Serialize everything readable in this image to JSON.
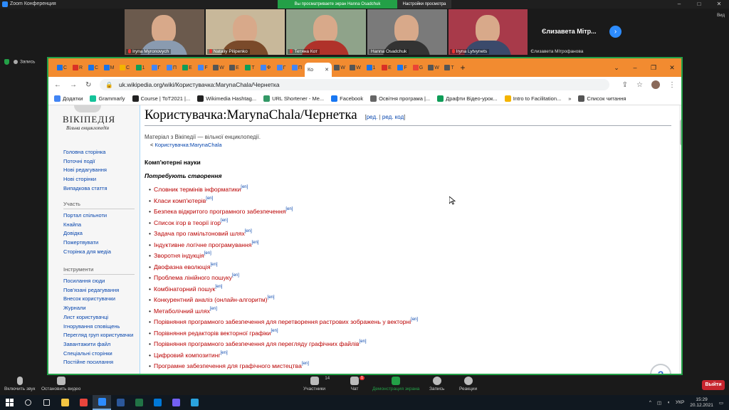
{
  "zoom": {
    "title": "Zoom Конференция",
    "sharing_banner": "Вы просматриваете экран Hanna Osadchuk",
    "view_options": "Настройки просмотра",
    "view_label": "Вид",
    "record_label": "Запись",
    "participants": [
      {
        "name": "Iryna Myronovych",
        "muted": true,
        "shirt": "#8a9bb0",
        "bg": "#6b5a4d"
      },
      {
        "name": "Nataliy Pilipenko",
        "muted": true,
        "shirt": "#7a4a2a",
        "bg": "#c8b89a"
      },
      {
        "name": "Тетяна Кот",
        "muted": true,
        "shirt": "#b0322a",
        "bg": "#8fa38a"
      },
      {
        "name": "Hanna Osadchuk",
        "muted": false,
        "shirt": "#333333",
        "bg": "#7a7a7a"
      },
      {
        "name": "Iryna Lytvynets",
        "muted": true,
        "shirt": "#3b4a6b",
        "bg": "#a83a4a"
      }
    ],
    "name_tile": {
      "big": "Єлизавета Мітр...",
      "name": "Єлизавета Мітрофанова"
    },
    "toolbar": {
      "unmute": "Включить звук",
      "video": "Остановить видео",
      "participants": "Участники",
      "participants_count": "14",
      "chat": "Чат",
      "chat_badge": "1",
      "share": "Демонстрация экрана",
      "record": "Запись",
      "reactions": "Реакции",
      "leave": "Выйти"
    }
  },
  "browser": {
    "tabs": [
      {
        "letter": "C",
        "color": "#1a73e8"
      },
      {
        "letter": "R",
        "color": "#d93025"
      },
      {
        "letter": "C",
        "color": "#1a73e8"
      },
      {
        "letter": "M",
        "color": "#1a73e8"
      },
      {
        "letter": "C",
        "color": "#f4b400"
      },
      {
        "letter": "1",
        "color": "#0f9d58"
      },
      {
        "letter": "Г",
        "color": "#4285f4"
      },
      {
        "letter": "П",
        "color": "#4285f4"
      },
      {
        "letter": "Е",
        "color": "#0f9d58"
      },
      {
        "letter": "F",
        "color": "#4285f4"
      },
      {
        "letter": "W",
        "color": "#555555"
      },
      {
        "letter": "E",
        "color": "#555555"
      },
      {
        "letter": "Т",
        "color": "#0f9d58"
      },
      {
        "letter": "Ф",
        "color": "#4285f4"
      },
      {
        "letter": "Г",
        "color": "#4285f4"
      },
      {
        "letter": "П",
        "color": "#4285f4"
      }
    ],
    "active_tab": "Ко",
    "tabs_after": [
      {
        "letter": "W",
        "color": "#555555"
      },
      {
        "letter": "W",
        "color": "#555555"
      },
      {
        "letter": "1",
        "color": "#1a73e8"
      },
      {
        "letter": "E",
        "color": "#d93025"
      },
      {
        "letter": "F",
        "color": "#1877f2"
      },
      {
        "letter": "G",
        "color": "#ea4335"
      },
      {
        "letter": "W",
        "color": "#555555"
      },
      {
        "letter": "T",
        "color": "#555555"
      }
    ],
    "url": "uk.wikipedia.org/wiki/Користувачка:MarynaChala/Чернетка",
    "bookmarks": [
      {
        "label": "Додатки",
        "color": "#4285f4"
      },
      {
        "label": "Grammarly",
        "color": "#15c39a"
      },
      {
        "label": "Course | ToT2021 |...",
        "color": "#222222"
      },
      {
        "label": "Wikimedia Hashtag...",
        "color": "#222222"
      },
      {
        "label": "URL Shortener - Me...",
        "color": "#339966"
      },
      {
        "label": "Facebook",
        "color": "#1877f2"
      },
      {
        "label": "Освітня програма |...",
        "color": "#666666"
      },
      {
        "label": "Драфти Відео-урок...",
        "color": "#0f9d58"
      },
      {
        "label": "Intro to Facilitation...",
        "color": "#f4b400"
      },
      {
        "label": "Список читання",
        "color": "#555555"
      }
    ]
  },
  "wiki": {
    "logo_title": "ВІКІПЕДІЯ",
    "logo_sub": "Вільна енциклопедія",
    "nav_main": [
      "Головна сторінка",
      "Поточні події",
      "Нові редагування",
      "Нові сторінки",
      "Випадкова стаття"
    ],
    "nav_participation_title": "Участь",
    "nav_participation": [
      "Портал спільноти",
      "Кнайпа",
      "Довідка",
      "Пожертвувати",
      "Сторінка для медіа"
    ],
    "nav_tools_title": "Інструменти",
    "nav_tools": [
      "Посилання сюди",
      "Пов'язані редагування",
      "Внесок користувачки",
      "Журнали",
      "Лист користувачці",
      "Ігнорування сповіщень",
      "Перегляд груп користувачки",
      "Завантажити файл",
      "Спеціальні сторінки",
      "Постійне посилання"
    ],
    "page_title": "Користувачка:MarynaChala/Чернетка",
    "edit": "ред.",
    "edit_code": "ред. код",
    "from_wiki": "Матеріал з Вікіпедії — вільної енциклопедії.",
    "breadcrumb_prefix": "<",
    "breadcrumb": "Користувачка:MarynaChala",
    "section": "Комп'ютерні науки",
    "subsection": "Потребують створення",
    "sup": "[en]",
    "items": [
      "Словник термінів інформатики",
      "Класи комп'ютерів",
      "Безпека відкритого програмного забезпечення",
      "Список ігор в теорії ігор",
      "Задача про гамільтоновий шлях",
      "Індуктивне логічне програмування",
      "Зворотня індукція",
      "Двофазна еволюція",
      "Проблема лінійного пошуку",
      "Комбінаторний пошук",
      "Конкурентний аналіз (онлайн-алгоритм)",
      "Метаболічний шлях",
      "Порівняння програмного забезпечення для перетворення растрових зображень у векторні",
      "Порівняння редакторів векторної графіки",
      "Порівняння програмного забезпечення для перегляду графічних файлів",
      "Цифровий композитинг",
      "Програмне забезпечення для графічного мистецтва"
    ],
    "help": "?"
  },
  "taskbar": {
    "lang": "УКР",
    "time": "15:29",
    "date": "20.12.2021",
    "apps": [
      {
        "name": "search-icon",
        "color": "#dddddd"
      },
      {
        "name": "task-view-icon",
        "color": "#dddddd"
      },
      {
        "name": "explorer-icon",
        "color": "#f4c542"
      },
      {
        "name": "chrome-icon",
        "color": "#e8453c"
      },
      {
        "name": "zoom-icon",
        "color": "#2d8cff"
      },
      {
        "name": "word-icon",
        "color": "#2b579a"
      },
      {
        "name": "excel-icon",
        "color": "#217346"
      },
      {
        "name": "photos-icon",
        "color": "#0078d7"
      },
      {
        "name": "viber-icon",
        "color": "#7360f2"
      },
      {
        "name": "telegram-icon",
        "color": "#2aa3de"
      }
    ]
  }
}
